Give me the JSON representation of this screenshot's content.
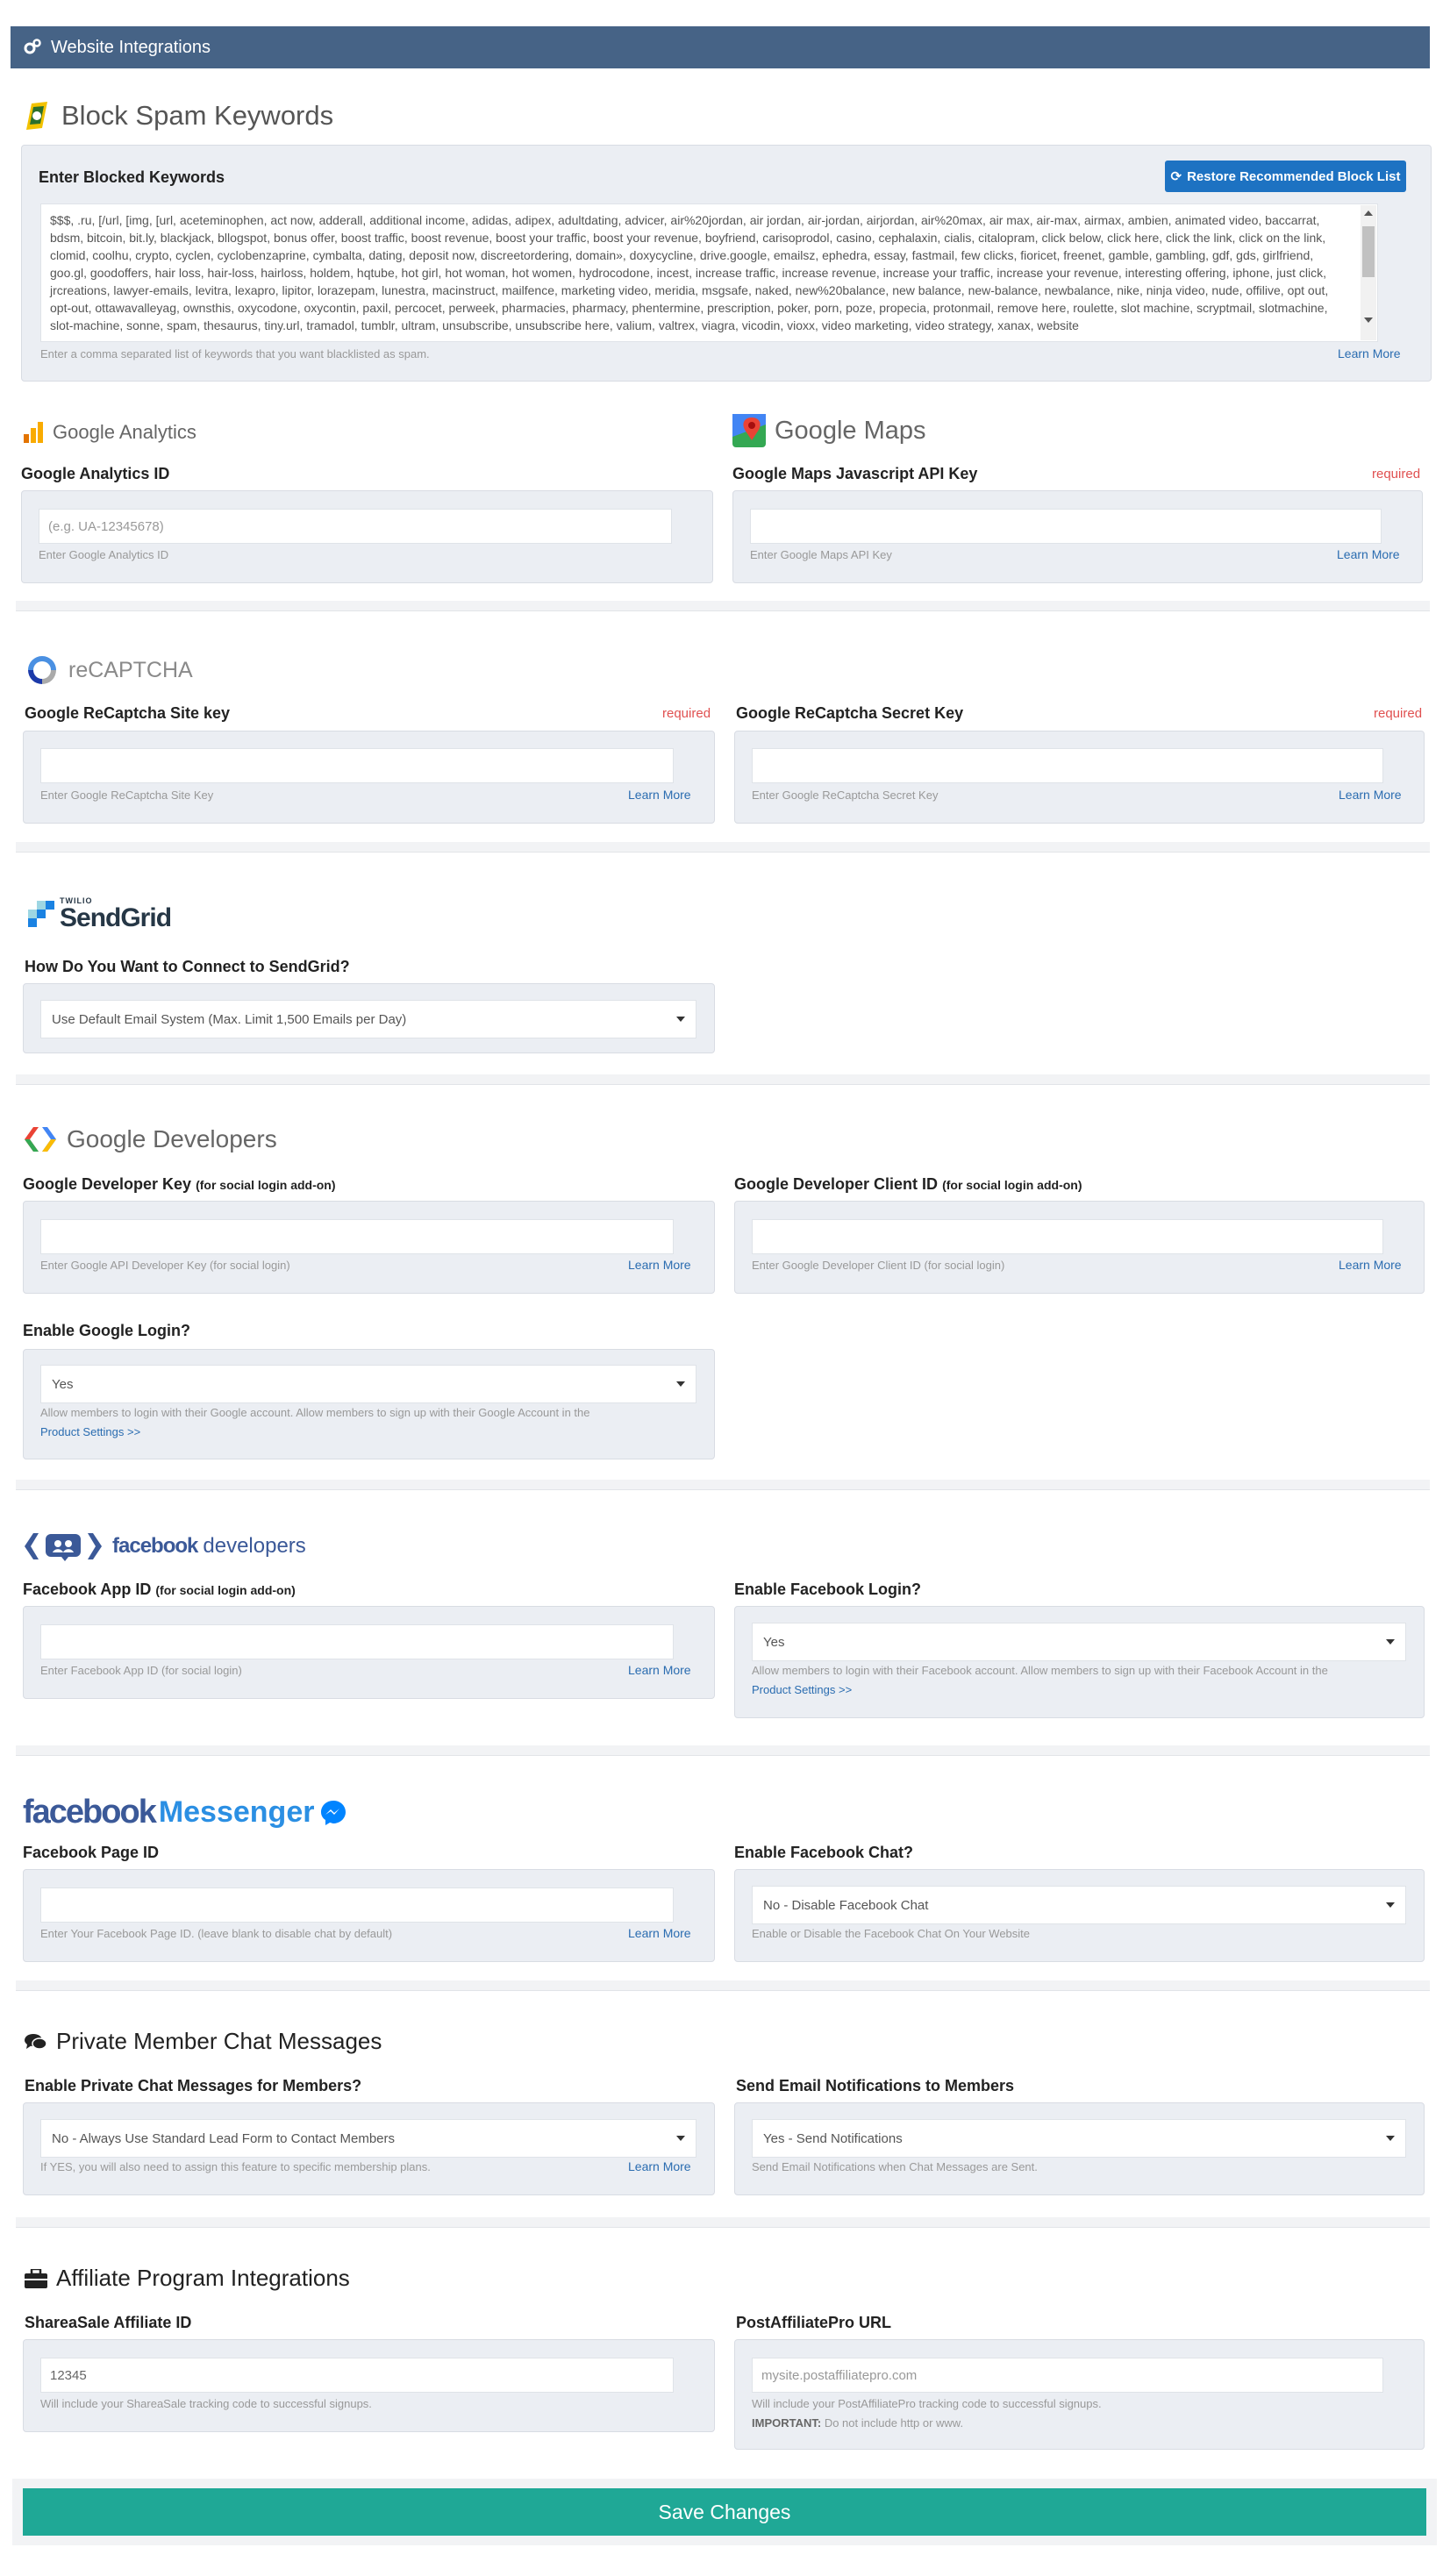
{
  "header": {
    "title": "Website Integrations",
    "icon": "gears-icon"
  },
  "spam": {
    "title": "Block Spam Keywords",
    "label": "Enter Blocked Keywords",
    "restore_label": "Restore Recommended Block List",
    "keywords": "$$$, .ru, [/url, [img, [url, aceteminophen, act now, adderall, additional income, adidas, adipex, adultdating, advicer, air%20jordan, air jordan, air-jordan, airjordan, air%20max, air max, air-max, airmax, ambien, animated video, baccarrat, bdsm, bitcoin, bit.ly, blackjack, bllogspot, bonus offer, boost traffic, boost revenue, boost your traffic, boost your revenue, boyfriend, carisoprodol, casino, cephalaxin, cialis, citalopram, click below, click here, click the link, click on the link, clomid, coolhu, crypto, cyclen, cyclobenzaprine, cymbalta, dating, deposit now, discreetordering, domain», doxycycline, drive.google, emailsz, ephedra, essay, fastmail, few clicks, fioricet, freenet, gamble, gambling, gdf, gds, girlfriend, goo.gl, goodoffers, hair loss, hair-loss, hairloss, holdem, hqtube, hot girl, hot woman, hot women, hydrocodone, incest, increase traffic, increase revenue, increase your traffic, increase your revenue, interesting offering, iphone, just click, jrcreations, lawyer-emails, levitra, lexapro, lipitor, lorazepam, lunestra, macinstruct, mailfence, marketing video, meridia, msgsafe, naked, new%20balance, new balance, new-balance, newbalance, nike, ninja video, nude, offilive, opt out, opt-out, ottawavalleyag, ownsthis, oxycodone, oxycontin, paxil, percocet, perweek, pharmacies, pharmacy, phentermine, prescription, poker, porn, poze, propecia, protonmail, remove here, roulette, slot machine, scryptmail, slotmachine, slot-machine, sonne, spam, thesaurus, tiny.url, tramadol, tumblr, ultram, unsubscribe, unsubscribe here, valium, valtrex, viagra, vicodin, vioxx, video marketing, video strategy, xanax, website",
    "help": "Enter a comma separated list of keywords that you want blacklisted as spam.",
    "learn_more": "Learn More"
  },
  "analytics": {
    "logo_text": "Google Analytics",
    "label": "Google Analytics ID",
    "placeholder": "(e.g. UA-12345678)",
    "help": "Enter Google Analytics ID"
  },
  "maps": {
    "logo_text": "Google Maps",
    "label": "Google Maps Javascript API Key",
    "required": "required",
    "help": "Enter Google Maps API Key",
    "learn_more": "Learn More"
  },
  "recaptcha": {
    "logo_text": "reCAPTCHA",
    "site_label": "Google ReCaptcha Site key",
    "site_required": "required",
    "site_help": "Enter Google ReCaptcha Site Key",
    "site_learn": "Learn More",
    "secret_label": "Google ReCaptcha Secret Key",
    "secret_required": "required",
    "secret_help": "Enter Google ReCaptcha Secret Key",
    "secret_learn": "Learn More"
  },
  "sendgrid": {
    "logo_small": "TWILIO",
    "logo_text": "SendGrid",
    "label": "How Do You Want to Connect to SendGrid?",
    "selected": "Use Default Email System (Max. Limit 1,500 Emails per Day)"
  },
  "google_dev": {
    "logo_text": "Google Developers",
    "key_label": "Google Developer Key",
    "key_label_small": "(for social login add-on)",
    "key_help": "Enter Google API Developer Key (for social login)",
    "key_learn": "Learn More",
    "client_label": "Google Developer Client ID",
    "client_label_small": "(for social login add-on)",
    "client_help": "Enter Google Developer Client ID (for social login)",
    "client_learn": "Learn More",
    "login_label": "Enable Google Login?",
    "login_selected": "Yes",
    "login_help": "Allow members to login with their Google account. Allow members to sign up with their Google Account in the",
    "login_link": "Product Settings >>"
  },
  "fb_dev": {
    "logo_word1": "facebook",
    "logo_word2": "developers",
    "app_label": "Facebook App ID",
    "app_label_small": "(for social login add-on)",
    "app_help": "Enter Facebook App ID (for social login)",
    "app_learn": "Learn More",
    "login_label": "Enable Facebook Login?",
    "login_selected": "Yes",
    "login_help": "Allow members to login with their Facebook account. Allow members to sign up with their Facebook Account in the",
    "login_link": "Product Settings >>"
  },
  "fb_messenger": {
    "logo_word1": "facebook",
    "logo_word2": "Messenger",
    "page_label": "Facebook Page ID",
    "page_help": "Enter Your Facebook Page ID. (leave blank to disable chat by default)",
    "page_learn": "Learn More",
    "chat_label": "Enable Facebook Chat?",
    "chat_selected": "No - Disable Facebook Chat",
    "chat_help": "Enable or Disable the Facebook Chat On Your Website"
  },
  "private_chat": {
    "title": "Private Member Chat Messages",
    "enable_label": "Enable Private Chat Messages for Members?",
    "enable_selected": "No - Always Use Standard Lead Form to Contact Members",
    "enable_help": "If YES, you will also need to assign this feature to specific membership plans.",
    "enable_learn": "Learn More",
    "notify_label": "Send Email Notifications to Members",
    "notify_selected": "Yes - Send Notifications",
    "notify_help": "Send Email Notifications when Chat Messages are Sent."
  },
  "affiliate": {
    "title": "Affiliate Program Integrations",
    "sas_label": "ShareaSale Affiliate ID",
    "sas_value": "12345",
    "sas_help": "Will include your ShareaSale tracking code to successful signups.",
    "pap_label": "PostAffiliatePro URL",
    "pap_placeholder": "mysite.postaffiliatepro.com",
    "pap_help": "Will include your PostAffiliatePro tracking code to successful signups.",
    "pap_important": "IMPORTANT:",
    "pap_important_text": "Do not include http or www."
  },
  "save_label": "Save Changes",
  "colors": {
    "header": "#466386",
    "accent": "#1d72c2",
    "save": "#1fa896",
    "required": "#e05050"
  }
}
